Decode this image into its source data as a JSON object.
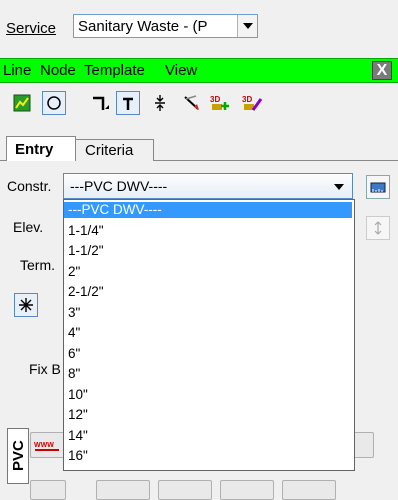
{
  "service": {
    "label": "Service",
    "value": "Sanitary Waste - (P"
  },
  "menubar": {
    "items": [
      "Line",
      "Node",
      "Template",
      "View"
    ],
    "close": "X"
  },
  "tabs": {
    "entry": "Entry",
    "criteria": "Criteria"
  },
  "fields": {
    "constr": "Constr.",
    "elev": "Elev.",
    "term": "Term.",
    "fixb": "Fix B"
  },
  "constr": {
    "value": "---PVC DWV----",
    "options": [
      "---PVC DWV----",
      "1-1/4\"",
      "1-1/2\"",
      "2\"",
      "2-1/2\"",
      "3\"",
      "4\"",
      "6\"",
      "8\"",
      "10\"",
      "12\"",
      "14\"",
      "16\""
    ],
    "selected_index": 0
  },
  "side_tab": {
    "label": "PVC"
  },
  "colors": {
    "menubar": "#00ff00",
    "selection": "#3399ff"
  }
}
